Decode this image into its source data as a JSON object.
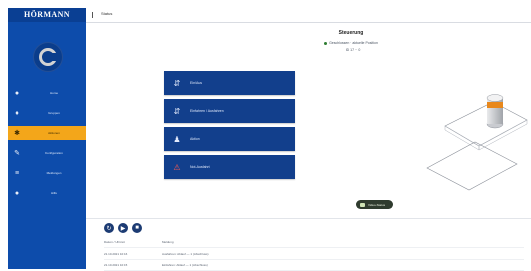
{
  "sidebar": {
    "brand": "HÖRMANN",
    "items": [
      {
        "icon": "home-icon",
        "glyph": "●",
        "label": "Home"
      },
      {
        "icon": "people-icon",
        "glyph": "♦",
        "label": "Gruppen"
      },
      {
        "icon": "functions-icon",
        "glyph": "✱",
        "label": "Aktionen",
        "active": true
      },
      {
        "icon": "wrench-icon",
        "glyph": "✎",
        "label": "Konfiguration"
      },
      {
        "icon": "list-icon",
        "glyph": "≡",
        "label": "Meldungen"
      },
      {
        "icon": "help-icon",
        "glyph": "●",
        "label": "Hilfe"
      }
    ]
  },
  "header": {
    "breadcrumb": "Status"
  },
  "main": {
    "title": "Steuerung",
    "status": "Geschlossen · aktuelle Position",
    "sub": "ID 17 ·· 0",
    "buttons": [
      {
        "icon": "up-down-icon",
        "glyph": "⇵",
        "label": "Ein/Aus"
      },
      {
        "icon": "up-down-icon",
        "glyph": "⇵",
        "label": "Einfahren / Ausfahren"
      },
      {
        "icon": "user-icon",
        "glyph": "♟",
        "label": "Aktion"
      },
      {
        "icon": "alert-icon",
        "glyph": "⚠",
        "label": "Not-Ausfahrt"
      }
    ],
    "info_badge": "Video-Status"
  },
  "bottom": {
    "buttons": [
      {
        "icon": "refresh-icon",
        "glyph": "↻"
      },
      {
        "icon": "play-icon",
        "glyph": "▶"
      },
      {
        "icon": "stop-icon",
        "glyph": "■"
      }
    ],
    "log": [
      {
        "time": "Datum / Uhrzeit",
        "message": "Meldung"
      },
      {
        "time": "21.10.2021 10:16",
        "message": "Ausfahren: Ablauf — 1 (Abschluss)"
      },
      {
        "time": "21.10.2021 10:15",
        "message": "Einfahren: Ablauf — 1 (Abschluss)"
      }
    ]
  },
  "colors": {
    "sidebar": "#0d4cab",
    "active": "#f3a61a",
    "button": "#123f8c",
    "bollard_orange": "#e8881c"
  }
}
